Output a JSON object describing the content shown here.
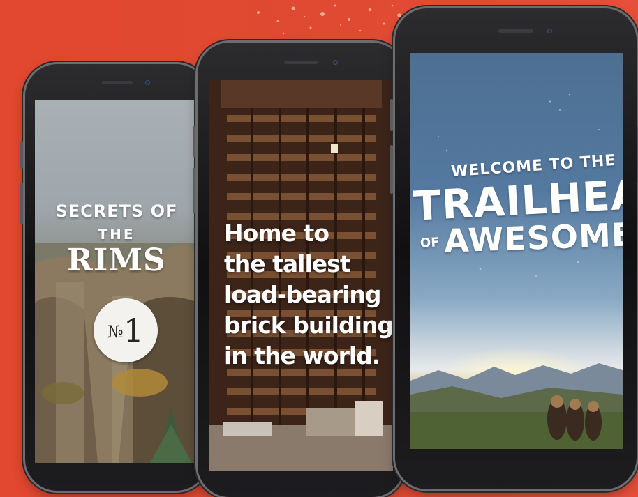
{
  "colors": {
    "background": "#e2472f",
    "phone_frame": "#141416",
    "text": "#ffffff"
  },
  "phones": [
    {
      "title_line1": "SECRETS OF",
      "title_line2": "THE",
      "title_line3": "RIMS",
      "badge_prefix": "№",
      "badge_number": "1"
    },
    {
      "lines": [
        "Home to",
        "the tallest",
        "load-bearing",
        "brick building",
        "in the world."
      ]
    },
    {
      "line1": "WELCOME TO THE",
      "line2": "TRAILHEAD",
      "line3_small": "OF",
      "line3": "AWESOME"
    }
  ]
}
